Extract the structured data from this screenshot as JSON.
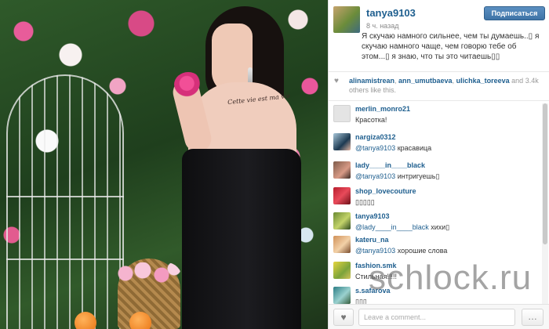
{
  "photo": {
    "tattoo_text": "Cette vie est ma vie"
  },
  "post": {
    "username": "tanya9103",
    "timestamp": "8 ч. назад",
    "follow_label": "Подписаться",
    "caption": "Я скучаю намного сильнее, чем ты думаешь..▯ я скучаю намного чаще, чем говорю тебе об этом...▯ я знаю, что ты это читаешь▯▯"
  },
  "likes": {
    "users": [
      "alinamistrean",
      "ann_umutbaeva",
      "ulichka_toreeva"
    ],
    "and_word": "and",
    "count": "3.4k",
    "suffix": "others like this.",
    "icon": "heart-icon"
  },
  "comments": [
    {
      "user": "merlin_monro21",
      "mention": "",
      "text": "Красотка!"
    },
    {
      "user": "nargiza0312",
      "mention": "@tanya9103",
      "text": "красавица"
    },
    {
      "user": "lady____in____black",
      "mention": "@tanya9103",
      "text": "интригуешь▯"
    },
    {
      "user": "shop_lovecouture",
      "mention": "",
      "text": "▯▯▯▯▯"
    },
    {
      "user": "tanya9103",
      "mention": "@lady____in____black",
      "text": "хихи▯"
    },
    {
      "user": "kateru_na",
      "mention": "@tanya9103",
      "text": "хорошие слова"
    },
    {
      "user": "fashion.smk",
      "mention": "",
      "text": "Стильная!!!!!"
    },
    {
      "user": "s.safarova",
      "mention": "",
      "text": "▯▯▯"
    }
  ],
  "footer": {
    "comment_placeholder": "Leave a comment...",
    "like_icon": "heart-icon",
    "more_icon": "ellipsis-icon"
  },
  "watermark": "schlock.ru"
}
